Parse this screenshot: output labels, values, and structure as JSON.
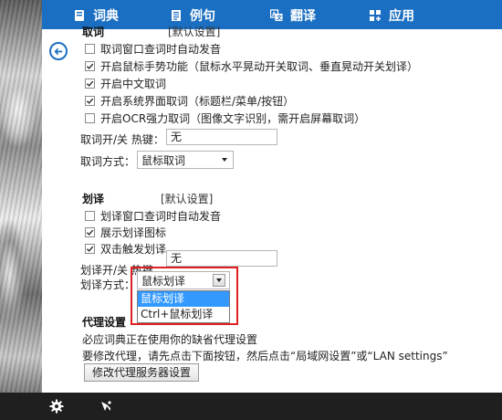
{
  "nav": {
    "items": [
      {
        "label": "词典",
        "icon": "book-icon"
      },
      {
        "label": "例句",
        "icon": "document-icon"
      },
      {
        "label": "翻译",
        "icon": "translate-icon"
      },
      {
        "label": "应用",
        "icon": "apps-icon"
      }
    ]
  },
  "lookup": {
    "title": "取词",
    "default_label": "[默认设置]",
    "options": [
      {
        "label": "取词窗口查词时自动发音",
        "checked": false
      },
      {
        "label": "开启鼠标手势功能（鼠标水平晃动开关取词、垂直晃动开关划译）",
        "checked": true
      },
      {
        "label": "开启中文取词",
        "checked": true
      },
      {
        "label": "开启系统界面取词（标题栏/菜单/按钮）",
        "checked": true
      },
      {
        "label": "开启OCR强力取词（图像文字识别，需开启屏幕取词）",
        "checked": false
      }
    ],
    "hotkey_label": "取词开/关 热键：",
    "hotkey_value": "无",
    "mode_label": "取词方式：",
    "mode_value": "鼠标取词"
  },
  "translate": {
    "title": "划译",
    "default_label": "[默认设置]",
    "options": [
      {
        "label": "划译窗口查词时自动发音",
        "checked": false
      },
      {
        "label": "展示划译图标",
        "checked": true
      },
      {
        "label": "双击触发划译",
        "checked": true
      }
    ],
    "hotkey_label": "划译开/关 热键：",
    "hotkey_value": "无",
    "mode_label": "划译方式：",
    "mode_value": "鼠标划译",
    "dropdown_options": [
      "鼠标划译",
      "Ctrl+鼠标划译"
    ],
    "dropdown_selected_index": 0
  },
  "proxy": {
    "title": "代理设置",
    "line1": "必应词典正在使用你的缺省代理设置",
    "line2": "要修改代理，请先点击下面按钮，然后点击“局域网设置”或“LAN settings”",
    "button_label": "修改代理服务器设置"
  },
  "colors": {
    "accent": "#1b6fc2",
    "highlight": "#e02020",
    "selection": "#3399ff",
    "bottom_bar": "#1f1f1f"
  }
}
